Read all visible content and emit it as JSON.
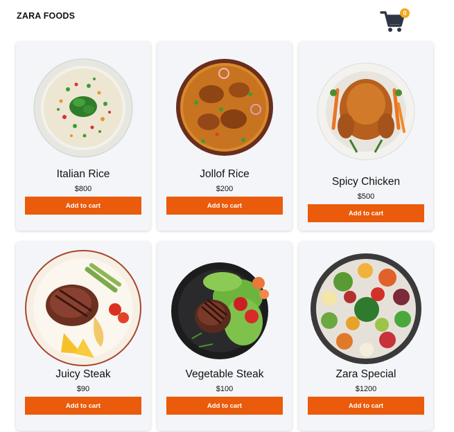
{
  "header": {
    "brand": "ZARA FOODS",
    "cart_count": "0"
  },
  "products": [
    {
      "name": "Italian Rice",
      "price": "$800",
      "button": "Add to cart"
    },
    {
      "name": "Jollof Rice",
      "price": "$200",
      "button": "Add to cart"
    },
    {
      "name": "Spicy Chicken",
      "price": "$500",
      "button": "Add to cart"
    },
    {
      "name": "Juicy Steak",
      "price": "$90",
      "button": "Add to cart"
    },
    {
      "name": "Vegetable Steak",
      "price": "$100",
      "button": "Add to cart"
    },
    {
      "name": "Zara Special",
      "price": "$1200",
      "button": "Add to cart"
    }
  ],
  "colors": {
    "accent": "#ea5b0c",
    "badge": "#f4a81c",
    "cart_icon": "#2f3645",
    "card_bg": "#f4f5f9"
  }
}
